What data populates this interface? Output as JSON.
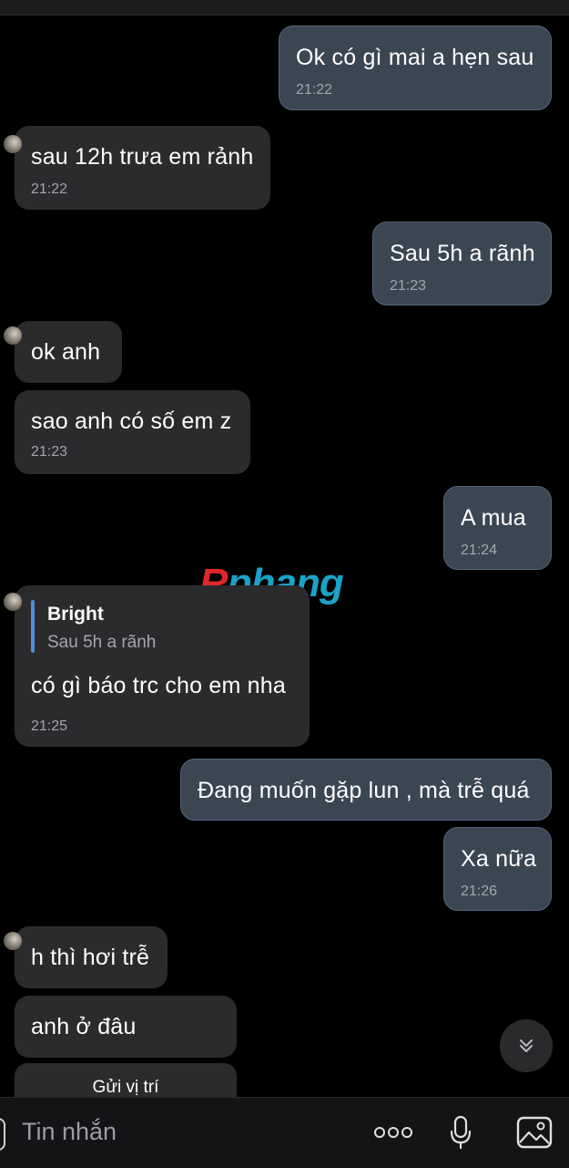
{
  "messages": [
    {
      "text": "Ok có gì mai a hẹn sau",
      "time": "21:22"
    },
    {
      "text": "sau 12h trưa em rảnh",
      "time": "21:22"
    },
    {
      "text": "Sau 5h a rãnh",
      "time": "21:23"
    },
    {
      "text": "ok anh",
      "time": ""
    },
    {
      "text": "sao anh có số em z",
      "time": "21:23"
    },
    {
      "text": "A mua",
      "time": "21:24"
    },
    {
      "text": "có gì báo trc cho em nha",
      "time": "21:25",
      "quote": {
        "name": "Bright",
        "text": "Sau 5h a rãnh"
      }
    },
    {
      "text": "Đang muốn gặp lun , mà trễ quá",
      "time": ""
    },
    {
      "text": "Xa nữa",
      "time": "21:26"
    },
    {
      "text": "h thì hơi trễ",
      "time": ""
    },
    {
      "text": "anh ở đâu",
      "time": ""
    }
  ],
  "location_button": "Gửi vị trí",
  "watermark": {
    "part1": "R",
    "part2": "phang"
  },
  "composer": {
    "placeholder": "Tin nhắn"
  },
  "icons": {
    "more": "more-dots-icon",
    "mic": "microphone-icon",
    "gallery": "image-gallery-icon",
    "scroll": "chevron-double-down-icon"
  },
  "colors": {
    "background": "#000000",
    "incoming_bubble": "#2b2b2e",
    "outgoing_bubble": "#3b4653",
    "quote_accent": "#4f8ed8"
  }
}
